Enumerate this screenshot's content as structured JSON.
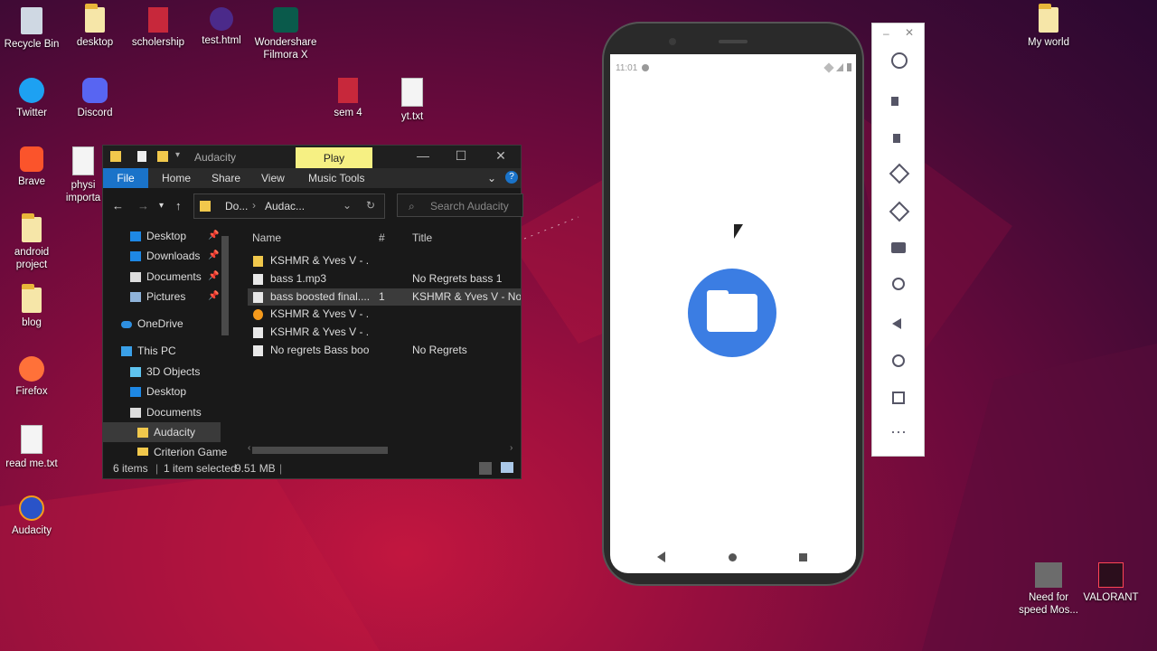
{
  "desktop": {
    "icons": [
      {
        "label": "Recycle Bin"
      },
      {
        "label": "desktop"
      },
      {
        "label": "scholership"
      },
      {
        "label": "test.html"
      },
      {
        "label": "Wondershare Filmora X"
      },
      {
        "label": "Twitter"
      },
      {
        "label": "Discord"
      },
      {
        "label": "sem 4"
      },
      {
        "label": "yt.txt"
      },
      {
        "label": "Brave"
      },
      {
        "label": "physi importa"
      },
      {
        "label": "android project"
      },
      {
        "label": "blog"
      },
      {
        "label": "Firefox"
      },
      {
        "label": "read me.txt"
      },
      {
        "label": "Audacity"
      },
      {
        "label": "My world"
      },
      {
        "label": "Need for speed Mos..."
      },
      {
        "label": "VALORANT"
      }
    ]
  },
  "explorer": {
    "title": "Audacity",
    "context_tab": "Play",
    "ribbon": {
      "file": "File",
      "home": "Home",
      "share": "Share",
      "view": "View",
      "music_tools": "Music Tools"
    },
    "address": {
      "seg1": "Do...",
      "seg2": "Audac..."
    },
    "search_placeholder": "Search Audacity",
    "nav": [
      {
        "label": "Desktop",
        "pinned": true
      },
      {
        "label": "Downloads",
        "pinned": true
      },
      {
        "label": "Documents",
        "pinned": true
      },
      {
        "label": "Pictures",
        "pinned": true
      },
      {
        "label": "OneDrive"
      },
      {
        "label": "This PC"
      },
      {
        "label": "3D Objects"
      },
      {
        "label": "Desktop"
      },
      {
        "label": "Documents"
      },
      {
        "label": "Audacity",
        "selected": true
      },
      {
        "label": "Criterion Game"
      }
    ],
    "columns": {
      "name": "Name",
      "num": "#",
      "title": "Title"
    },
    "files": [
      {
        "name": "KSHMR & Yves V - ...",
        "num": "",
        "title": "",
        "kind": "folder"
      },
      {
        "name": "bass 1.mp3",
        "num": "",
        "title": "No Regrets bass 1",
        "kind": "audio"
      },
      {
        "name": "bass boosted final....",
        "num": "1",
        "title": "KSHMR & Yves V - No R",
        "kind": "audio",
        "selected": true
      },
      {
        "name": "KSHMR & Yves V - ...",
        "num": "",
        "title": "",
        "kind": "audacity"
      },
      {
        "name": "KSHMR & Yves V - ...",
        "num": "",
        "title": "",
        "kind": "audio"
      },
      {
        "name": "No regrets Bass boo...",
        "num": "",
        "title": "No Regrets",
        "kind": "audio"
      }
    ],
    "status": {
      "count": "6 items",
      "selected": "1 item selected",
      "size": "9.51 MB"
    }
  },
  "phone": {
    "time": "11:01"
  },
  "colors": {
    "accent": "#1a73c9",
    "play_tab": "#f6f083",
    "files_blue": "#3b7de3"
  }
}
